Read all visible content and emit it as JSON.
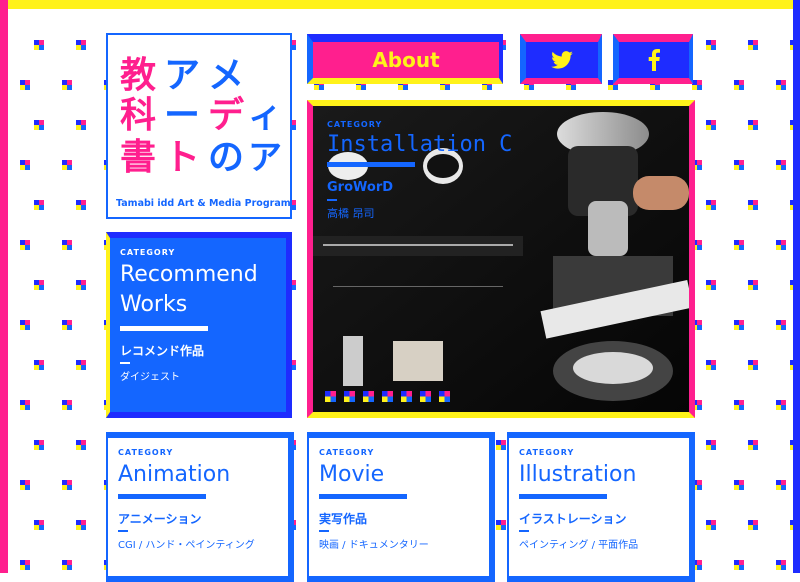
{
  "logo": {
    "chars": [
      "メ",
      "ア",
      "教",
      "デ",
      "|",
      "科",
      "ィ",
      "ト",
      "書",
      "ア",
      "の"
    ],
    "subtitle": "Tamabi idd Art & Media Program"
  },
  "nav": {
    "about_label": "About",
    "twitter_icon": "twitter-bird-icon",
    "facebook_icon": "facebook-f-icon"
  },
  "hero": {
    "category": "CATEGORY",
    "title": "Installation C",
    "artist": "GroWorD",
    "person": "高橋 昂司"
  },
  "cards": {
    "recommend": {
      "category": "CATEGORY",
      "title": "Recommend Works",
      "jp": "レコメンド作品",
      "desc": "ダイジェスト"
    },
    "animation": {
      "category": "CATEGORY",
      "title": "Animation",
      "jp": "アニメーション",
      "desc": "CGI / ハンド・ペインティング"
    },
    "movie": {
      "category": "CATEGORY",
      "title": "Movie",
      "jp": "実写作品",
      "desc": "映画 / ドキュメンタリー"
    },
    "illustration": {
      "category": "CATEGORY",
      "title": "Illustration",
      "jp": "イラストレーション",
      "desc": "ペインティング / 平面作品"
    }
  },
  "colors": {
    "pink": "#ff1f8e",
    "blue": "#1466ff",
    "navy": "#1e2cff",
    "yellow": "#fff21a"
  }
}
